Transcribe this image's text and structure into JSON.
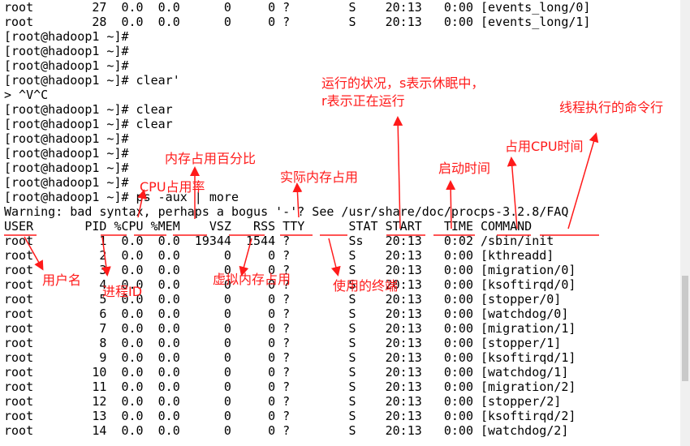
{
  "terminal": {
    "lines": [
      "root        27  0.0  0.0      0     0 ?        S    20:13   0:00 [events_long/0]",
      "root        28  0.0  0.0      0     0 ?        S    20:13   0:00 [events_long/1]",
      "[root@hadoop1 ~]#",
      "[root@hadoop1 ~]#",
      "[root@hadoop1 ~]#",
      "[root@hadoop1 ~]# clear'",
      "> ^V^C",
      "[root@hadoop1 ~]# clear",
      "[root@hadoop1 ~]# clear",
      "[root@hadoop1 ~]#",
      "[root@hadoop1 ~]#",
      "[root@hadoop1 ~]#",
      "[root@hadoop1 ~]#",
      "[root@hadoop1 ~]# ps -aux | more",
      "Warning: bad syntax, perhaps a bogus '-'? See /usr/share/doc/procps-3.2.8/FAQ",
      "USER       PID %CPU %MEM    VSZ   RSS TTY      STAT START   TIME COMMAND",
      "root         1  0.0  0.0  19344  1544 ?        Ss   20:13   0:02 /sbin/init",
      "root         2  0.0  0.0      0     0 ?        S    20:13   0:00 [kthreadd]",
      "root         3  0.0  0.0      0     0 ?        S    20:13   0:00 [migration/0]",
      "root         4  0.0  0.0      0     0 ?        S    20:13   0:00 [ksoftirqd/0]",
      "root         5  0.0  0.0      0     0 ?        S    20:13   0:00 [stopper/0]",
      "root         6  0.0  0.0      0     0 ?        S    20:13   0:00 [watchdog/0]",
      "root         7  0.0  0.0      0     0 ?        S    20:13   0:00 [migration/1]",
      "root         8  0.0  0.0      0     0 ?        S    20:13   0:00 [stopper/1]",
      "root         9  0.0  0.0      0     0 ?        S    20:13   0:00 [ksoftirqd/1]",
      "root        10  0.0  0.0      0     0 ?        S    20:13   0:00 [watchdog/1]",
      "root        11  0.0  0.0      0     0 ?        S    20:13   0:00 [migration/2]",
      "root        12  0.0  0.0      0     0 ?        S    20:13   0:00 [stopper/2]",
      "root        13  0.0  0.0      0     0 ?        S    20:13   0:00 [ksoftirqd/2]",
      "root        14  0.0  0.0      0     0 ?        S    20:13   0:00 [watchdog/2]"
    ]
  },
  "annotations": {
    "status_line1": "运行的状况，s表示休眠中，",
    "status_line2": "r表示正在运行",
    "command": "线程执行的命令行",
    "cpu_time": "占用CPU时间",
    "start_time": "启动时间",
    "mem_percent": "内存占用百分比",
    "rss": "实际内存占用",
    "cpu_rate": "CPU占用率",
    "user": "用户名",
    "pid": "进程ID",
    "vsz": "虚拟内存占用",
    "tty": "使用的终端"
  },
  "colors": {
    "annotation": "#ff1a1a",
    "text": "#000000",
    "background": "#ffffff"
  }
}
